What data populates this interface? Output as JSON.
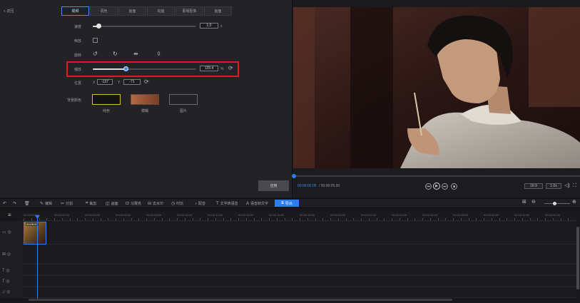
{
  "panel": {
    "back_label": "< 返回",
    "tabs": [
      "视频",
      "调色",
      "画面",
      "动画",
      "蒙版抠像",
      "画面"
    ],
    "speed": {
      "label": "速度",
      "value": "1.0",
      "unit": "x",
      "fraction": 0.06
    },
    "reverse": {
      "label": "倒放"
    },
    "rotate": {
      "label": "旋转"
    },
    "scale": {
      "label": "缩放",
      "value": "129.4",
      "unit": "%",
      "fraction": 0.32
    },
    "position": {
      "label": "位置",
      "x_label": "X",
      "x_value": "-137",
      "y_label": "Y",
      "y_value": "-71"
    },
    "background": {
      "label": "背景颜色",
      "options": [
        {
          "label": "纯色",
          "color": "#141414",
          "border": "#d4c31a"
        },
        {
          "label": "模糊",
          "color": "#9a5a3a",
          "border": "#6a4a3a"
        },
        {
          "label": "图片",
          "color": "#232327",
          "border": "#6a6a6e"
        }
      ]
    },
    "apply_label": "应用"
  },
  "player": {
    "current_time": "00:00:00.00",
    "total_time": "/ 00:00:05.00",
    "quality": "16:9",
    "speed": "1.0x",
    "progress": 0.0
  },
  "toolbar": {
    "tools": [
      {
        "icon": "↶",
        "label": "",
        "name": "undo"
      },
      {
        "icon": "↷",
        "label": "",
        "name": "redo"
      },
      {
        "icon": "🗑",
        "label": "",
        "name": "delete"
      },
      {
        "icon": "✎",
        "label": "编辑",
        "name": "edit"
      },
      {
        "icon": "✂",
        "label": "分割",
        "name": "split"
      },
      {
        "icon": "⌗",
        "label": "裁剪",
        "name": "crop"
      },
      {
        "icon": "◫",
        "label": "画面",
        "name": "frame"
      },
      {
        "icon": "⊡",
        "label": "马赛克",
        "name": "mosaic"
      },
      {
        "icon": "⊟",
        "label": "去水印",
        "name": "watermark"
      },
      {
        "icon": "◷",
        "label": "时长",
        "name": "duration"
      },
      {
        "icon": "♪",
        "label": "配音",
        "name": "dubbing"
      },
      {
        "icon": "T",
        "label": "文字转语音",
        "name": "tts"
      },
      {
        "icon": "A",
        "label": "语音转文字",
        "name": "stt"
      }
    ],
    "export_label": "导出"
  },
  "timeline": {
    "ticks": [
      "00:00:00:00",
      "00:00:02:00",
      "00:00:04:00",
      "00:00:06:00",
      "00:00:08:00",
      "00:00:10:00",
      "00:00:12:00",
      "00:00:14:00",
      "00:00:16:00",
      "00:00:18:00",
      "00:00:20:00",
      "00:00:22:00",
      "00:00:24:00",
      "00:00:26:00",
      "00:00:28:00",
      "00:00:30:00",
      "00:00:32:00",
      "00:00:34:00"
    ],
    "clip_label": "00:05:00"
  }
}
